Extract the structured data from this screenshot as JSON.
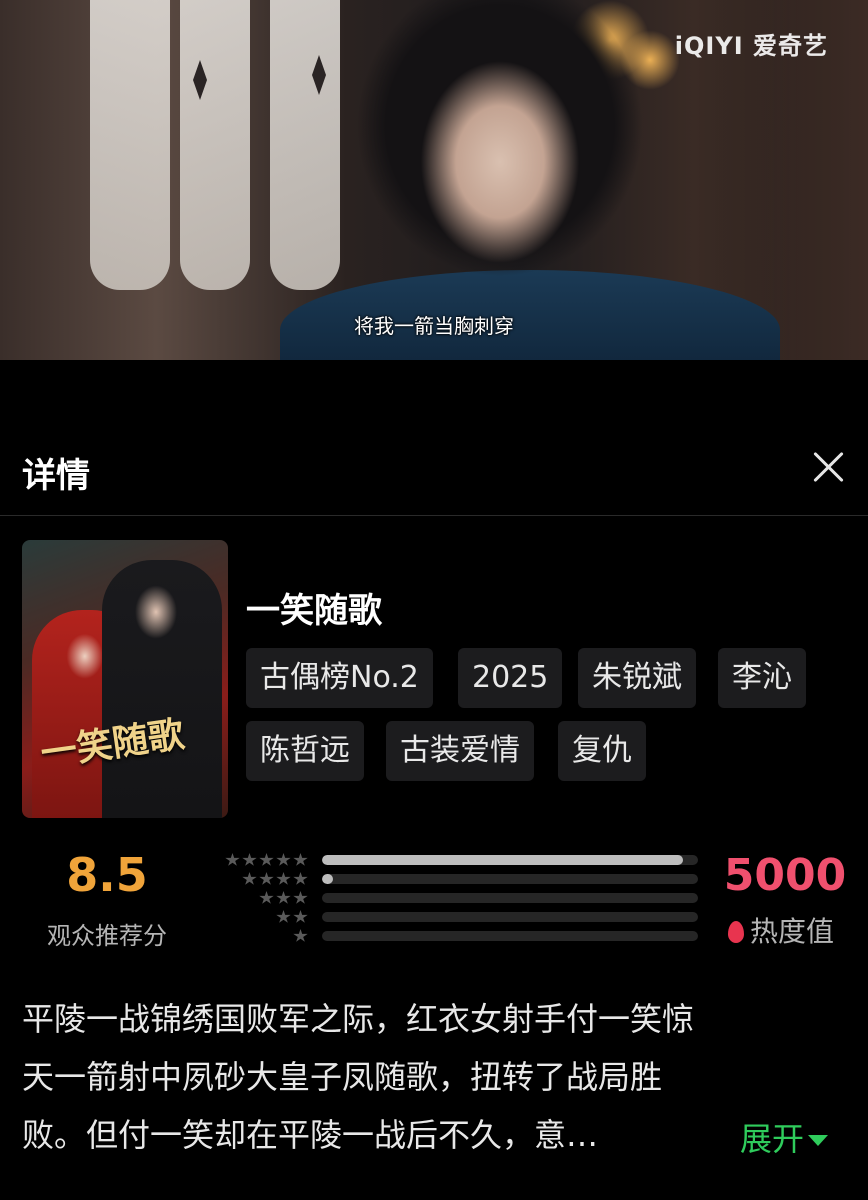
{
  "video": {
    "subtitle": "将我一箭当胸刺穿",
    "watermark": "iQIYI 爱奇艺"
  },
  "header": {
    "title": "详情",
    "close_icon": "close-icon"
  },
  "show": {
    "title": "一笑随歌",
    "poster_title": "一笑随歌",
    "tags": [
      "古偶榜No.2",
      "2025",
      "朱锐斌",
      "李沁",
      "陈哲远",
      "古装爱情",
      "复仇"
    ]
  },
  "rating": {
    "score": "8.5",
    "score_label": "观众推荐分",
    "distribution": [
      {
        "stars": 5,
        "fraction": 0.96
      },
      {
        "stars": 4,
        "fraction": 0.03
      },
      {
        "stars": 3,
        "fraction": 0.0
      },
      {
        "stars": 2,
        "fraction": 0.0
      },
      {
        "stars": 1,
        "fraction": 0.0
      }
    ],
    "heat_value": "5000",
    "heat_label": "热度值",
    "heat_color": "#f0506e",
    "score_color": "#f0a43a"
  },
  "description": {
    "lines": [
      "平陵一战锦绣国败军之际，红衣女射手付一笑惊",
      "天一箭射中夙砂大皇子凤随歌，扭转了战局胜",
      "败。但付一笑却在平陵一战后不久，意…"
    ],
    "expand_label": "展开",
    "expand_color": "#2fcc5c"
  }
}
